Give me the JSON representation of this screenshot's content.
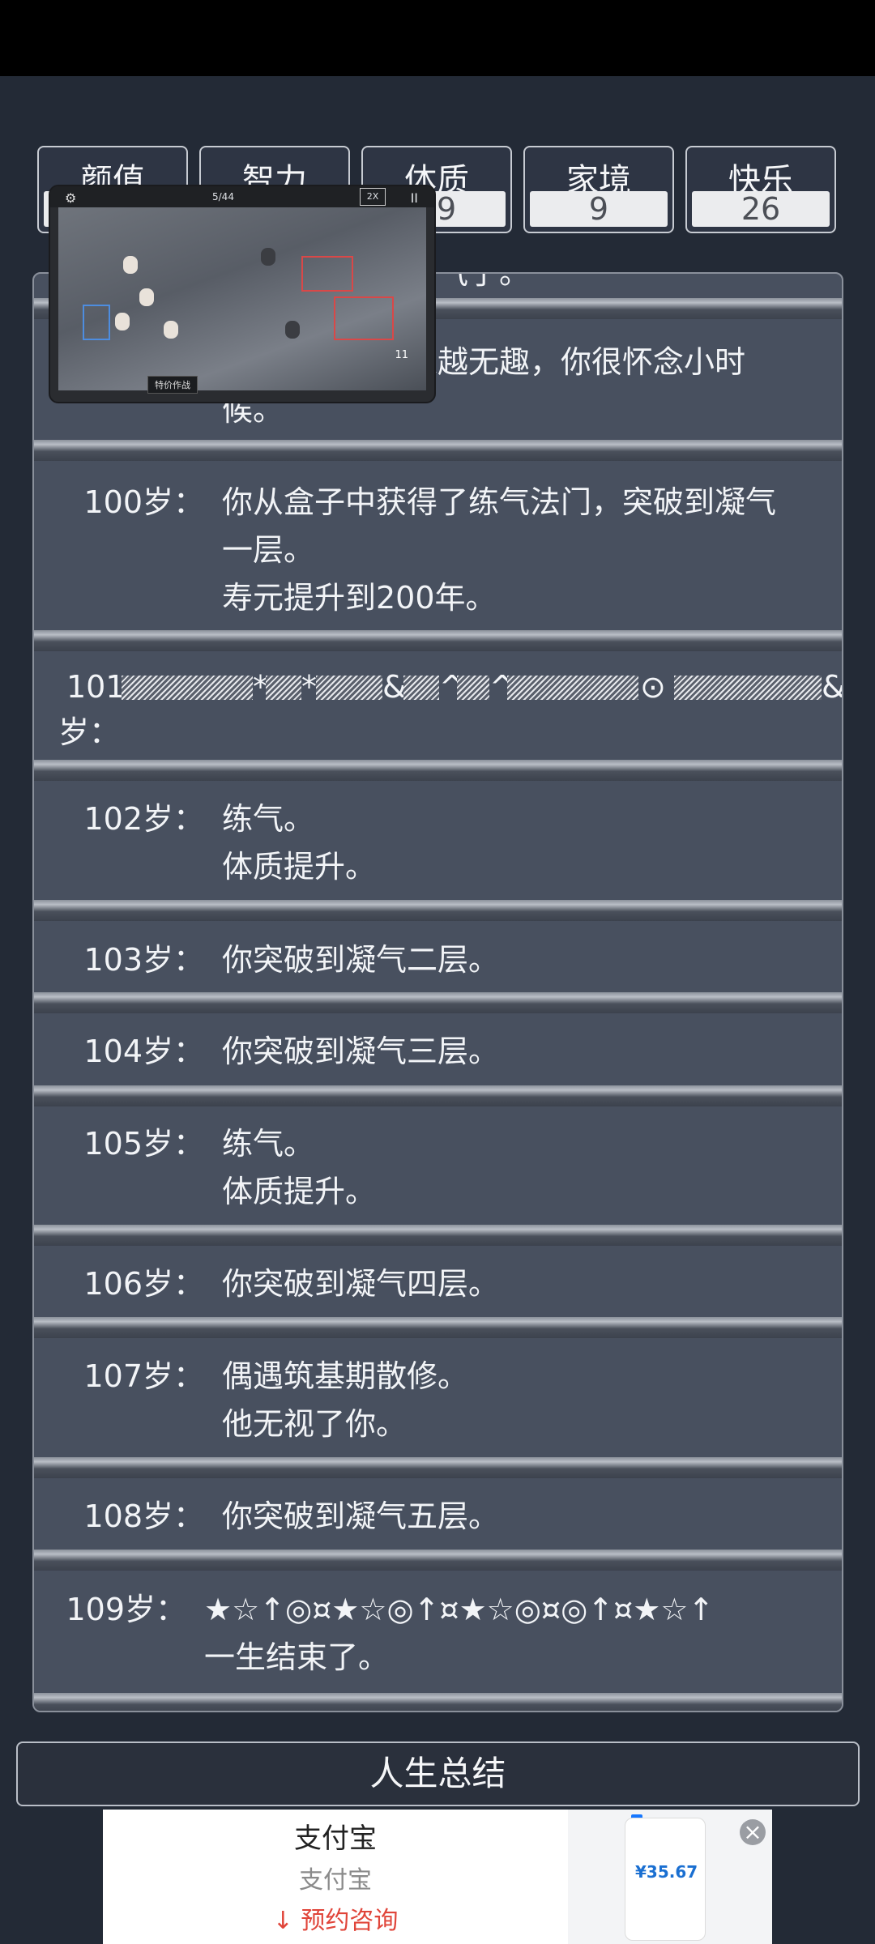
{
  "stats": [
    {
      "label": "颜值",
      "value": ""
    },
    {
      "label": "智力",
      "value": ""
    },
    {
      "label": "体质",
      "value": "29"
    },
    {
      "label": "家境",
      "value": "9"
    },
    {
      "label": "快乐",
      "value": "26"
    }
  ],
  "log": {
    "partial_top": "终于吸到新鲜空气了。",
    "partial_age99_text": "你觉得生活越来越无趣，你很怀念小时\n候。",
    "entries": [
      {
        "age": "100岁：",
        "text": "你从盒子中获得了练气法门，突破到凝气\n一层。\n寿元提升到200年。"
      },
      {
        "age": "102岁：",
        "text": "练气。\n体质提升。"
      },
      {
        "age": "103岁：",
        "text": "你突破到凝气二层。"
      },
      {
        "age": "104岁：",
        "text": "你突破到凝气三层。"
      },
      {
        "age": "105岁：",
        "text": "练气。\n体质提升。"
      },
      {
        "age": "106岁：",
        "text": "你突破到凝气四层。"
      },
      {
        "age": "107岁：",
        "text": "偶遇筑基期散修。\n他无视了你。"
      },
      {
        "age": "108岁：",
        "text": "你突破到凝气五层。"
      },
      {
        "age": "109岁：",
        "text": "★☆↑◎¤★☆◎↑¤★☆◎¤◎↑¤★☆↑\n一生结束了。"
      }
    ],
    "corrupt": {
      "age": "101",
      "suffix": "岁：",
      "symbols": [
        "*",
        "*",
        "&",
        "^",
        "^",
        "⊙",
        "&"
      ]
    }
  },
  "overlay": {
    "counter": "5/44",
    "speed": "2X",
    "pause": "II",
    "count": "11",
    "button": "特价作战"
  },
  "summary_label": "人生总结",
  "ad": {
    "title": "支付宝",
    "subtitle": "支付宝",
    "cta": "预约咨询",
    "price": "¥35.67",
    "close": "×"
  }
}
